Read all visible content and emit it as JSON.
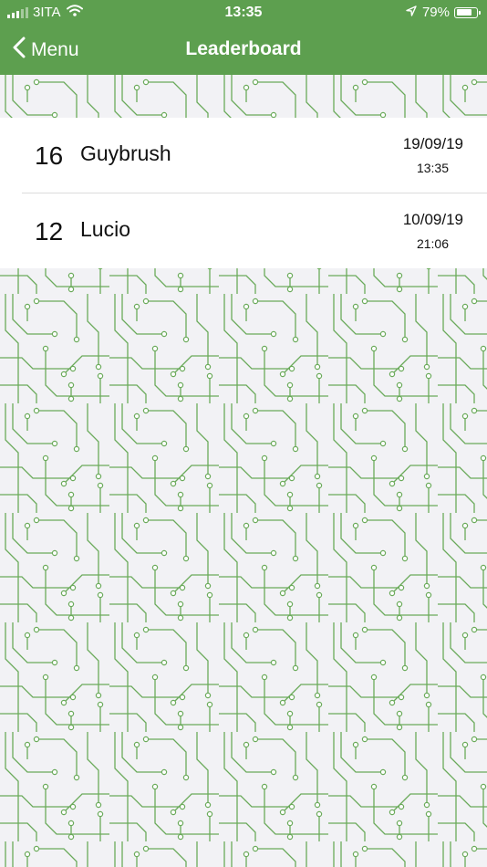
{
  "status_bar": {
    "carrier": "3ITA",
    "time": "13:35",
    "battery_percent": "79%",
    "battery_level": 0.79,
    "icons": [
      "signal-icon",
      "wifi-icon",
      "location-arrow-icon",
      "battery-icon"
    ]
  },
  "nav": {
    "back_label": "Menu",
    "title": "Leaderboard",
    "back_icon": "chevron-left-icon"
  },
  "leaderboard": [
    {
      "score": "16",
      "name": "Guybrush",
      "date": "19/09/19",
      "time": "13:35"
    },
    {
      "score": "12",
      "name": "Lucio",
      "date": "10/09/19",
      "time": "21:06"
    }
  ],
  "colors": {
    "header": "#5d9f4f",
    "circuit": "#6aaa5a",
    "background": "#f2f2f5"
  }
}
